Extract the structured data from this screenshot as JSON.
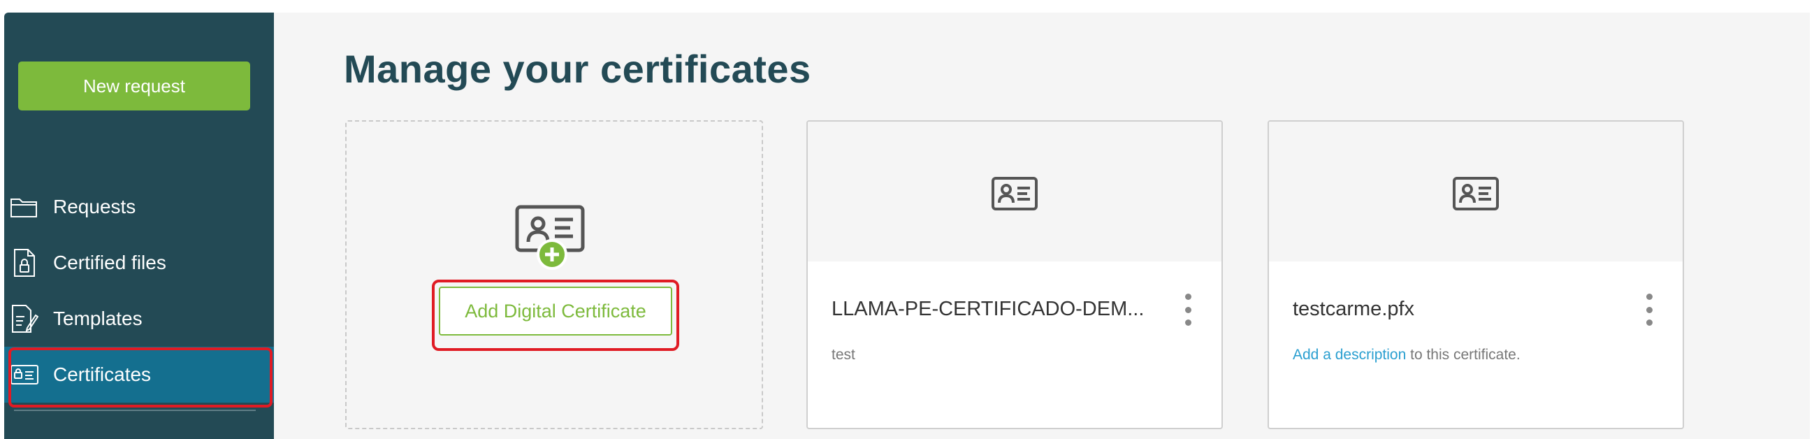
{
  "sidebar": {
    "new_request_label": "New request",
    "items": [
      {
        "label": "Requests",
        "icon": "folder-icon"
      },
      {
        "label": "Certified files",
        "icon": "locked-file-icon"
      },
      {
        "label": "Templates",
        "icon": "template-edit-icon"
      },
      {
        "label": "Certificates",
        "icon": "certificate-icon",
        "active": true
      }
    ]
  },
  "main": {
    "title": "Manage your certificates",
    "add_card": {
      "button_label": "Add Digital Certificate",
      "icon": "certificate-add-icon"
    },
    "certificates": [
      {
        "name": "LLAMA-PE-CERTIFICADO-DEM...",
        "description": "test"
      },
      {
        "name": "testcarme.pfx",
        "description_link": "Add a description",
        "description_rest": " to this certificate."
      }
    ]
  },
  "colors": {
    "sidebar_bg": "#234a55",
    "active_bg": "#146f8f",
    "accent_green": "#7dba3c",
    "title_color": "#234a55",
    "link_color": "#2a9fd0",
    "highlight_red": "#e01b24"
  }
}
